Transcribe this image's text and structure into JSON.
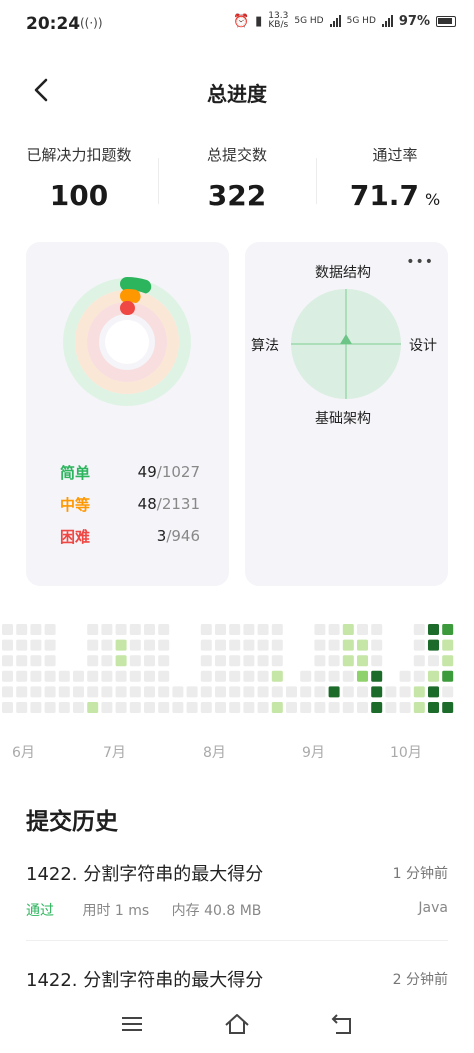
{
  "status_bar": {
    "time": "20:24",
    "cast_icon": "cast-icon",
    "net_speed_value": "13.3",
    "net_speed_unit": "KB/s",
    "signal1_label": "5G HD",
    "signal2_label": "5G HD",
    "battery_percent": "97%"
  },
  "nav": {
    "title": "总进度",
    "back_icon": "chevron-left-icon"
  },
  "stats": [
    {
      "label": "已解决力扣题数",
      "value": "100",
      "unit": ""
    },
    {
      "label": "总提交数",
      "value": "322",
      "unit": ""
    },
    {
      "label": "通过率",
      "value": "71.7",
      "unit": "%"
    }
  ],
  "difficulty": [
    {
      "name": "简单",
      "solved": "49",
      "total": "/1027",
      "color": "#2db55d",
      "ring_color": "#dff3e4",
      "fraction": 0.048
    },
    {
      "name": "中等",
      "solved": "48",
      "total": "/2131",
      "color": "#ff9800",
      "ring_color": "#fbe7d6",
      "fraction": 0.023
    },
    {
      "name": "困难",
      "solved": "3",
      "total": "/946",
      "color": "#ef4743",
      "ring_color": "#f8dede",
      "fraction": 0.003
    }
  ],
  "radar": {
    "more_icon": "more-horizontal-icon",
    "labels": {
      "top": "数据结构",
      "left": "算法",
      "right": "设计",
      "bottom": "基础架构"
    },
    "fill_color": "#dbeee2",
    "accent_color": "#2db55d"
  },
  "heatmap": {
    "months": [
      "6月",
      "7月",
      "8月",
      "9月",
      "10月"
    ],
    "empty_color": "#ececec",
    "levels": [
      "#ececec",
      "#c5e6a6",
      "#8fd16a",
      "#3c9a3c",
      "#1d6b2a"
    ],
    "columns": [
      [
        0,
        0,
        0,
        0,
        0,
        0
      ],
      [
        0,
        0,
        0,
        0,
        0,
        0
      ],
      [
        0,
        0,
        0,
        0,
        0,
        0
      ],
      [
        0,
        0,
        0,
        0,
        0,
        0
      ],
      [
        null,
        null,
        null,
        0,
        0,
        0
      ],
      [
        null,
        null,
        null,
        0,
        0,
        0
      ],
      [
        0,
        0,
        0,
        0,
        0,
        1
      ],
      [
        0,
        0,
        0,
        0,
        0,
        0
      ],
      [
        0,
        1,
        1,
        0,
        0,
        0
      ],
      [
        0,
        0,
        0,
        0,
        0,
        0
      ],
      [
        0,
        0,
        0,
        0,
        0,
        0
      ],
      [
        0,
        0,
        0,
        0,
        0,
        0
      ],
      [
        null,
        null,
        null,
        null,
        0,
        0
      ],
      [
        null,
        null,
        null,
        null,
        0,
        0
      ],
      [
        0,
        0,
        0,
        0,
        0,
        0
      ],
      [
        0,
        0,
        0,
        0,
        0,
        0
      ],
      [
        0,
        0,
        0,
        0,
        0,
        0
      ],
      [
        0,
        0,
        0,
        0,
        0,
        0
      ],
      [
        0,
        0,
        0,
        0,
        0,
        0
      ],
      [
        0,
        0,
        0,
        1,
        0,
        1
      ],
      [
        null,
        null,
        null,
        null,
        0,
        0
      ],
      [
        null,
        null,
        null,
        0,
        0,
        0
      ],
      [
        0,
        0,
        0,
        0,
        0,
        0
      ],
      [
        0,
        0,
        0,
        0,
        4,
        0
      ],
      [
        1,
        1,
        1,
        0,
        0,
        0
      ],
      [
        0,
        1,
        1,
        2,
        0,
        0
      ],
      [
        0,
        0,
        0,
        4,
        4,
        4
      ],
      [
        null,
        null,
        null,
        null,
        0,
        0
      ],
      [
        null,
        null,
        null,
        0,
        0,
        0
      ],
      [
        0,
        0,
        0,
        0,
        1,
        1
      ],
      [
        4,
        4,
        0,
        1,
        4,
        4
      ],
      [
        3,
        1,
        1,
        3,
        0,
        4
      ],
      [
        null,
        null,
        null,
        null,
        null,
        null
      ]
    ]
  },
  "history": {
    "title": "提交历史",
    "items": [
      {
        "name": "1422. 分割字符串的最大得分",
        "time": "1 分钟前",
        "status": "通过",
        "runtime": "用时 1 ms",
        "memory": "内存 40.8 MB",
        "language": "Java"
      },
      {
        "name": "1422. 分割字符串的最大得分",
        "time": "2 分钟前"
      }
    ]
  },
  "bottom_nav": {
    "menu_icon": "menu-icon",
    "home_icon": "home-icon",
    "back_icon": "back-arrow-icon"
  }
}
